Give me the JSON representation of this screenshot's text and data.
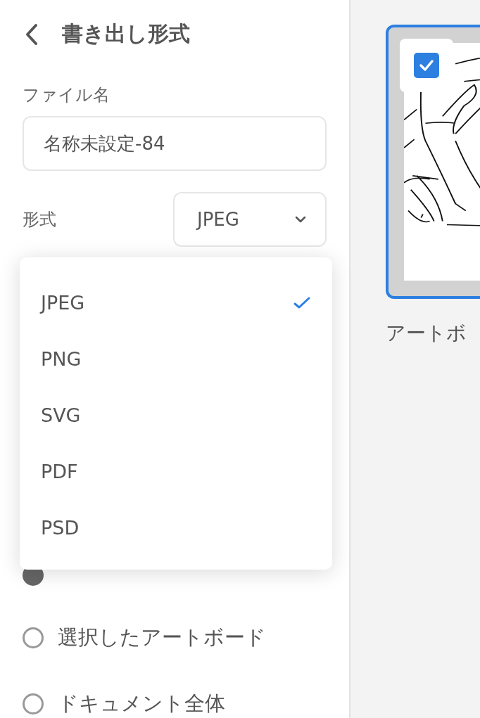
{
  "header": {
    "title": "書き出し形式"
  },
  "file_name": {
    "label": "ファイル名",
    "value": "名称未設定-84"
  },
  "format": {
    "label": "形式",
    "value": "JPEG",
    "expanded": true
  },
  "format_menu": [
    {
      "label": "JPEG",
      "selected": true
    },
    {
      "label": "PNG",
      "selected": false
    },
    {
      "label": "SVG",
      "selected": false
    },
    {
      "label": "PDF",
      "selected": false
    },
    {
      "label": "PSD",
      "selected": false
    }
  ],
  "scope": [
    {
      "selected": true
    },
    {
      "label": "選択したアートボード",
      "selected": false
    },
    {
      "label": "ドキュメント全体",
      "selected": false
    }
  ],
  "artboard": {
    "checked": true,
    "label": "アートボ"
  }
}
